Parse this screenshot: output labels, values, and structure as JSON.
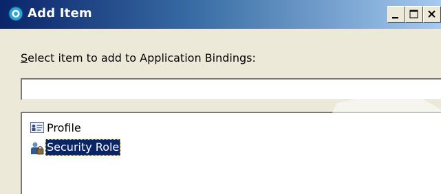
{
  "window": {
    "title": "Add Item",
    "icon": "eclipse-app-icon",
    "caption_buttons": [
      "minimize",
      "maximize",
      "close"
    ]
  },
  "dialog": {
    "prompt_mnemonic": "S",
    "prompt_rest": "elect item to add to Application Bindings:",
    "filter_value": "",
    "items": [
      {
        "label": "Profile",
        "icon": "profile-card-icon",
        "selected": false
      },
      {
        "label": "Security Role",
        "icon": "security-role-icon",
        "selected": true
      }
    ]
  },
  "colors": {
    "titlebar_start": "#0a246a",
    "titlebar_end": "#a6caf0",
    "window_bg": "#ece9d8",
    "selection_bg": "#0a246a",
    "selection_text": "#ffffff"
  }
}
